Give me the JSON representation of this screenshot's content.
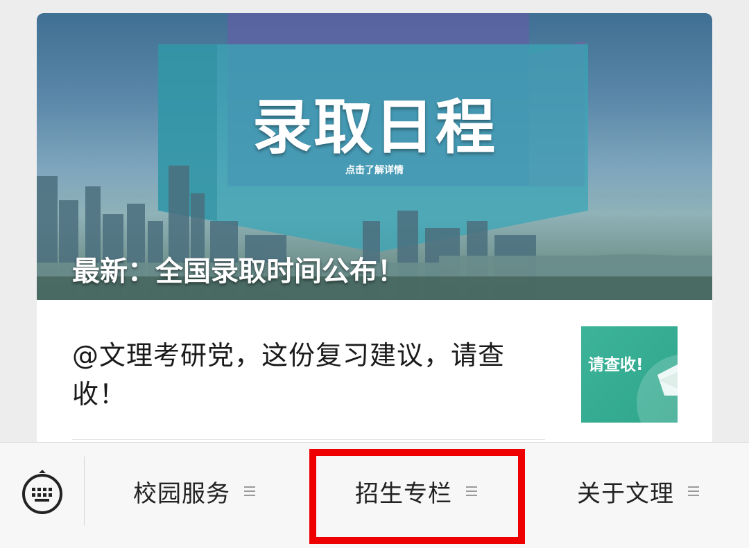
{
  "article_feed": {
    "banner": {
      "title": "录取日程",
      "subtitle": "点击了解详情",
      "caption": "最新：全国录取时间公布！"
    },
    "article": {
      "title": "@文理考研党，这份复习建议，请查收！",
      "thumbnail_text": "请查收!"
    }
  },
  "bottom_menu": {
    "keyboard_icon": "keyboard-icon",
    "items": [
      {
        "label": "校园服务",
        "icon": "menu-lines-icon"
      },
      {
        "label": "招生专栏",
        "icon": "menu-lines-icon"
      },
      {
        "label": "关于文理",
        "icon": "menu-lines-icon"
      }
    ],
    "highlight_color": "#ee0000"
  }
}
